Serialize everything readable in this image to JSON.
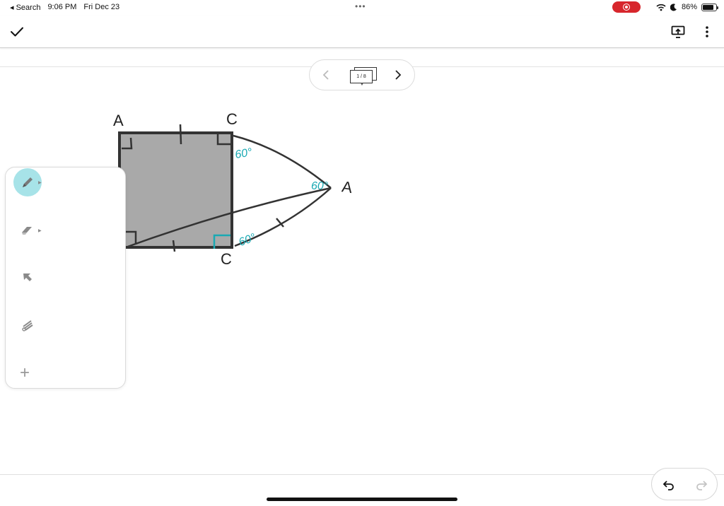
{
  "status_bar": {
    "back_label": "◂ Search",
    "time": "9:06 PM",
    "date": "Fri Dec 23",
    "battery": "86%",
    "icons": [
      "record-icon",
      "wifi-icon",
      "moon-icon",
      "battery-icon"
    ]
  },
  "toolbar": {
    "done_icon": "checkmark-icon",
    "present_icon": "present-icon",
    "more_icon": "more-vertical-icon"
  },
  "page_nav": {
    "page_indicator": "1 / 8"
  },
  "drawing": {
    "vertex_labels": [
      "A",
      "C",
      "C",
      "A"
    ],
    "angle_labels": [
      "60°",
      "60°",
      "60°"
    ],
    "ink_colors": {
      "square_fill": "#a9a9a9",
      "stroke": "#333333",
      "annotation": "#1aa9b3"
    }
  },
  "palette": {
    "tools": [
      {
        "name": "pen",
        "icon": "pen-icon",
        "active": true
      },
      {
        "name": "eraser",
        "icon": "eraser-icon",
        "active": false
      },
      {
        "name": "select",
        "icon": "select-arrow-icon",
        "active": false
      },
      {
        "name": "laser",
        "icon": "laser-pointer-icon",
        "active": false
      }
    ],
    "add_label": "+"
  },
  "accent_color": "#a7e3e8",
  "record_color": "#d7262c"
}
